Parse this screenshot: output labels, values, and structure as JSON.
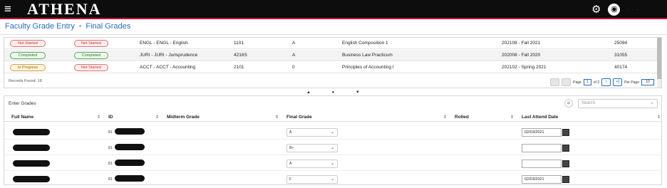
{
  "app": {
    "brand": "ATHENA",
    "menu_icon": "≡",
    "gear_icon": "⚙",
    "user_icon": "◉",
    "dots": "· · ·"
  },
  "breadcrumb": {
    "item1": "Faculty Grade Entry",
    "sep": "•",
    "item2": "Final Grades"
  },
  "courses": [
    {
      "status1": "Not Started",
      "status2": "Not Started",
      "s1c": "red",
      "s2c": "red",
      "subject": "ENGL - ENGL - English",
      "number": "1101",
      "section": "A",
      "title": "English Composition 1",
      "term": "202108 - Fall 2021",
      "crn": "25094"
    },
    {
      "status1": "Completed",
      "status2": "Completed",
      "s1c": "green",
      "s2c": "green",
      "subject": "JURI - JURI - Jurisprudence",
      "number": "4216S",
      "section": "A",
      "title": "Business Law Practicum",
      "term": "202008 - Fall 2020",
      "crn": "31055"
    },
    {
      "status1": "In Progress",
      "status2": "Not Started",
      "s1c": "orange",
      "s2c": "red",
      "subject": "ACCT - ACCT - Accounting",
      "number": "2101",
      "section": "0",
      "title": "Principles of Accounting I",
      "term": "202102 - Spring 2021",
      "crn": "40174"
    }
  ],
  "records": "Records Found: 18",
  "pager": {
    "page_label": "Page",
    "page": "1",
    "of": "of 2",
    "next": "›",
    "last": "»|",
    "per_page_label": "Per Page",
    "per_page": "10"
  },
  "collapse_icons": "▲ ● ▼",
  "grades": {
    "title": "Enter Grades",
    "grid_icon": "⊞",
    "search_placeholder": "Search",
    "search_icon": "⌕",
    "headers": {
      "full_name": "Full Name",
      "id": "ID",
      "midterm": "Midterm Grade",
      "final": "Final Grade",
      "rolled": "Rolled",
      "last_attend": "Last Attend Date"
    },
    "sort_icon": "⇕",
    "rows": [
      {
        "id_prefix": "81",
        "final": "A",
        "date": "02/03/2021"
      },
      {
        "id_prefix": "81",
        "final": "B+",
        "date": ""
      },
      {
        "id_prefix": "81",
        "final": "A",
        "date": ""
      },
      {
        "id_prefix": "81",
        "final": "F",
        "date": "02/03/2021"
      }
    ]
  }
}
